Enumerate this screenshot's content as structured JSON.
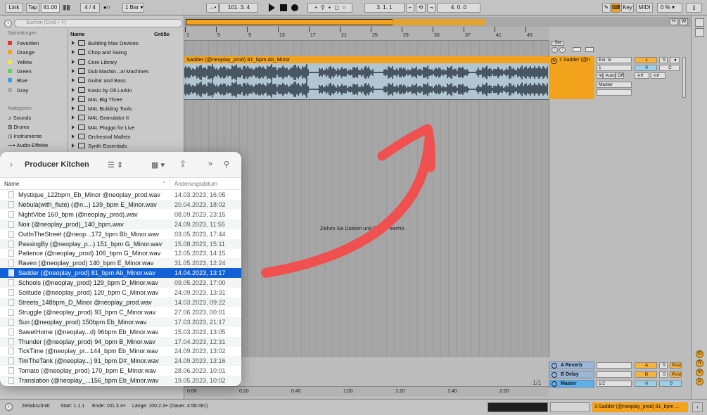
{
  "topbar": {
    "link": "Link",
    "tap": "Tap",
    "tempo": "81.00",
    "signature": "4 / 4",
    "metro": "●○",
    "quantize": "1 Bar",
    "position": "101.  3.  4",
    "loop_start": "3.  1.  1",
    "loop_length": "4.  0.  0",
    "key": "Key",
    "midi": "MIDI",
    "cpu": "0 %"
  },
  "browser": {
    "search_placeholder": "Suchen (Cmd + F)",
    "collections_title": "Sammlungen",
    "collections": [
      {
        "label": "Favoriten",
        "color": "#e8352b"
      },
      {
        "label": "Orange",
        "color": "#f2a21b"
      },
      {
        "label": "Yellow",
        "color": "#f0e83a"
      },
      {
        "label": "Green",
        "color": "#5fd35a"
      },
      {
        "label": "Blue",
        "color": "#3b9fe8"
      },
      {
        "label": "Gray",
        "color": "#a8a8a8"
      }
    ],
    "categories_title": "Kategorien",
    "categories": [
      {
        "label": "Sounds",
        "icon": "sounds-icon"
      },
      {
        "label": "Drums",
        "icon": "drums-icon"
      },
      {
        "label": "Instrumente",
        "icon": "instruments-icon"
      },
      {
        "label": "Audio-Effekte",
        "icon": "audio-effects-icon"
      }
    ],
    "name_header": "Name",
    "size_header": "Größe",
    "items": [
      "Building Max Devices",
      "Chop and Swing",
      "Core Library",
      "Dub Machin...al Machines",
      "Guitar and Bass",
      "Kasio by Oli Larkin",
      "M4L Big Three",
      "M4L Building Tools",
      "M4L Granulator II",
      "M4L Pluggo for Live",
      "Orchestral Mallets",
      "Synth Essentials"
    ]
  },
  "ruler": {
    "ticks": [
      "1",
      "5",
      "9",
      "13",
      "17",
      "21",
      "25",
      "29",
      "33",
      "37",
      "41",
      "45"
    ]
  },
  "clip": {
    "title": "Sadder (@neoplay_prod) 81_bpm Ab_Minor"
  },
  "track": {
    "name": "1 Sadder (@n",
    "input": "Ext. In",
    "input_ch": "1",
    "number": "1",
    "zero": "0",
    "pan": "C",
    "modes": [
      "In",
      "Auto",
      "Off"
    ],
    "output": "Master",
    "vol": "-inf",
    "vol2": "-inf",
    "solo": "S"
  },
  "drop_hint": "Ziehen Sie Dateien und Geräte hierhin.",
  "returns": [
    {
      "label": "A Reverb",
      "letter": "A",
      "post": "Post"
    },
    {
      "label": "B Delay",
      "letter": "B",
      "post": "Post"
    }
  ],
  "master": {
    "label": "Master",
    "meter": "1/2",
    "zero": "0"
  },
  "set_label": "Set",
  "page_indicator": "1/1",
  "bottom_times": [
    "0:00",
    "0:20",
    "0:40",
    "1:00",
    "1:20",
    "1:40",
    "2:00"
  ],
  "status": {
    "section": "Zeitabschnitt",
    "start": "Start: 1.1.1",
    "end": "Ende: 101.3.4+",
    "length": "Länge: 100.2.3+ (Dauer: 4:58:491)",
    "clip_info": "1-Sadder (@neoplay_prod) 81_bpm ..."
  },
  "finder": {
    "title": "Producer Kitchen",
    "col_name": "Name",
    "col_date": "Änderungsdatum",
    "rows": [
      {
        "name": "Mystique_122bpm_Eb_Minor @neoplay_prod.wav",
        "date": "14.03.2023, 16:05"
      },
      {
        "name": "Nebula(with_flute) (@n...) 139_bpm E_Minor.wav",
        "date": "20.04.2023, 18:02"
      },
      {
        "name": "NightVibe 160_bpm (@neoplay_prod).wav",
        "date": "08.09.2023, 23:15"
      },
      {
        "name": "Noir (@neoplay_prod)_140_bpm.wav",
        "date": "24.09.2023, 11:55"
      },
      {
        "name": "OutInTheStreet (@neop...172_bpm Bb_Minor.wav",
        "date": "03.05.2023, 17:44"
      },
      {
        "name": "PassingBy (@neoplay_p...) 151_bpm G_Minor.wav",
        "date": "15.08.2023, 15:11"
      },
      {
        "name": "Patience (@neoplay_prod) 106_bpm G_Minor.wav",
        "date": "12.05.2023, 14:15"
      },
      {
        "name": "Raven (@neoplay_prod) 140_bpm E_Minor.wav",
        "date": "31.05.2023, 12:24"
      },
      {
        "name": "Sadder (@neoplay_prod) 81_bpm Ab_Minor.wav",
        "date": "14.04.2023, 13:17"
      },
      {
        "name": "Schools (@neoplay_prod) 129_bpm D_Minor.wav",
        "date": "09.05.2023, 17:00"
      },
      {
        "name": "Solitude (@neoplay_prod) 120_bpm C_Minor.wav",
        "date": "24.09.2023, 13:31"
      },
      {
        "name": "Streets_148bpm_D_Minor @neoplay_prod.wav",
        "date": "14.03.2023, 09:22"
      },
      {
        "name": "Struggle (@neoplay_prod) 93_bpm C_Minor.wav",
        "date": "27.06.2023, 00:01"
      },
      {
        "name": "Sun (@neoplay_prod) 150bpm Eb_Minor.wav",
        "date": "17.03.2023, 21:17"
      },
      {
        "name": "SweetHome (@neoplay...d) 96bpm Eb_Minor.wav",
        "date": "15.03.2023, 13:05"
      },
      {
        "name": "Thunder (@neoplay_prod) 94_bpm B_Minor.wav",
        "date": "17.04.2023, 12:31"
      },
      {
        "name": "TickTime (@neoplay_pr...144_bpm Eb_Minor.wav",
        "date": "24.09.2023, 13:02"
      },
      {
        "name": "TimTheTank (@neoplay...) 91_bpm D#_Minor.wav",
        "date": "24.09.2023, 13:16"
      },
      {
        "name": "Tomato (@neoplay_prod) 170_bpm E_Minor.wav",
        "date": "28.06.2023, 10:01"
      },
      {
        "name": "Translation (@neoplay_...156_bpm Eb_Minor.wav",
        "date": "19.05.2023, 10:02"
      }
    ],
    "selected_index": 8
  },
  "annotation": {
    "arrow_color": "#f0504f"
  }
}
